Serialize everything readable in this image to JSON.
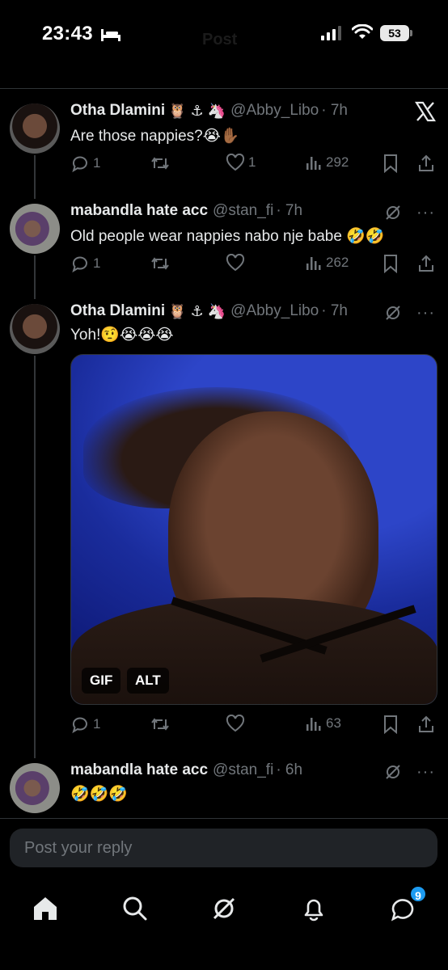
{
  "status_bar": {
    "time": "23:43",
    "battery": "53",
    "faded_title": "Post"
  },
  "tweets": [
    {
      "name": "Otha Dlamini",
      "name_emojis": "🦉 ⚓ 🦄",
      "handle": "@Abby_Libo",
      "time": "· 7h",
      "text": "Are those nappies?😭✋🏾",
      "replies": "1",
      "retweets": "",
      "likes": "1",
      "views": "292"
    },
    {
      "name": "mabandla hate acc",
      "name_emojis": "",
      "handle": "@stan_fi",
      "time": "· 7h",
      "text": "Old people wear nappies nabo nje babe 🤣🤣",
      "replies": "1",
      "retweets": "",
      "likes": "",
      "views": "262"
    },
    {
      "name": "Otha Dlamini",
      "name_emojis": "🦉 ⚓ 🦄",
      "handle": "@Abby_Libo",
      "time": "· 7h",
      "text": "Yoh!🤨😭😭😭",
      "media_badges": {
        "gif": "GIF",
        "alt": "ALT"
      },
      "replies": "1",
      "retweets": "",
      "likes": "",
      "views": "63"
    },
    {
      "name": "mabandla hate acc",
      "name_emojis": "",
      "handle": "@stan_fi",
      "time": "· 6h",
      "text": "🤣🤣🤣"
    }
  ],
  "reply": {
    "placeholder": "Post your reply"
  },
  "nav": {
    "messages_badge": "9"
  },
  "colors": {
    "background": "#000000",
    "text": "#e7e9ea",
    "muted": "#71767b",
    "accent": "#1d9bf0"
  },
  "icons": [
    "bed-icon",
    "signal-icon",
    "wifi-icon",
    "x-logo-icon",
    "grok-icon",
    "more-icon",
    "reply-icon",
    "retweet-icon",
    "like-icon",
    "views-icon",
    "bookmark-icon",
    "share-icon",
    "home-icon",
    "search-icon",
    "notifications-icon",
    "messages-icon"
  ]
}
